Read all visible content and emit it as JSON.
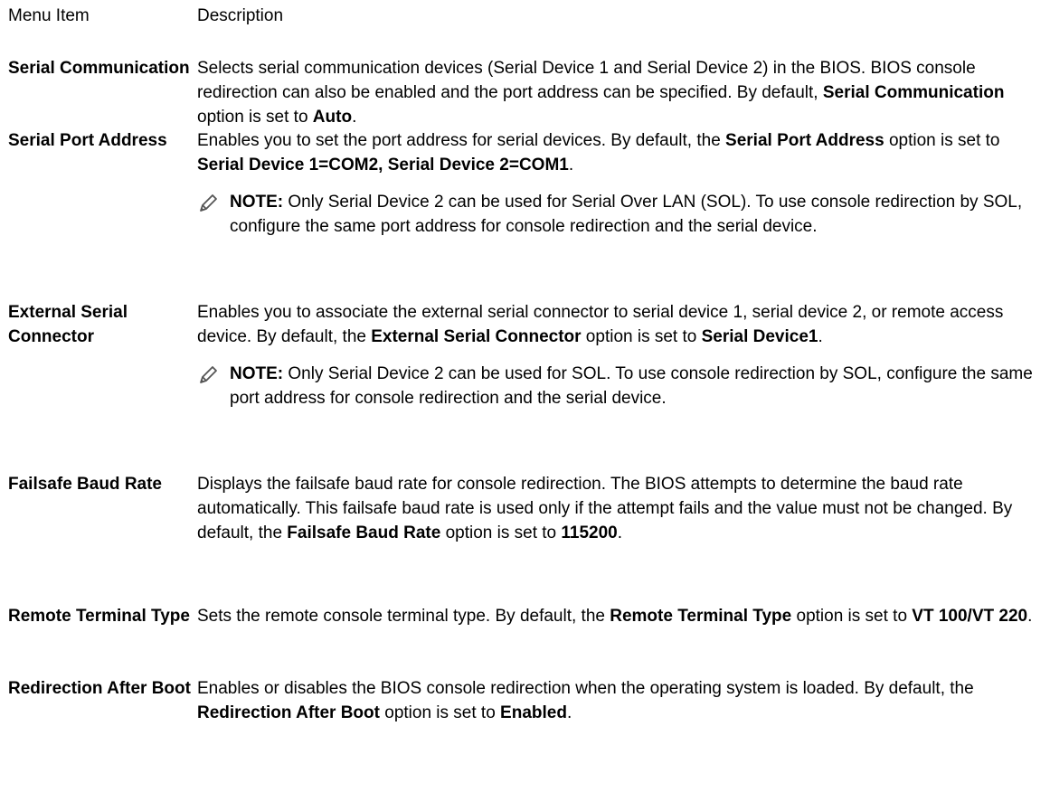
{
  "header": {
    "menu_item": "Menu Item",
    "description": "Description"
  },
  "rows": [
    {
      "name": "Serial Communication",
      "desc": [
        {
          "t": "Selects serial communication devices (Serial Device 1 and Serial Device 2) in the BIOS. BIOS console redirection can also be enabled and the port address can be specified. By default, "
        },
        {
          "t": "Serial Communication",
          "b": true
        },
        {
          "t": " option is set to "
        },
        {
          "t": "Auto",
          "b": true
        },
        {
          "t": "."
        }
      ]
    },
    {
      "name": "Serial Port Address",
      "desc": [
        {
          "t": "Enables you to set the port address for serial devices. By default, the "
        },
        {
          "t": "Serial Port Address",
          "b": true
        },
        {
          "t": " option is set to "
        },
        {
          "t": "Serial Device 1=COM2, Serial Device 2=COM1",
          "b": true
        },
        {
          "t": "."
        }
      ],
      "note": {
        "icon": "note-pencil-icon",
        "label": "NOTE:",
        "text": " Only Serial Device 2 can be used for Serial Over LAN (SOL). To use console redirection by SOL, configure the same port address for console redirection and the serial device."
      }
    },
    {
      "name": "External Serial Connector",
      "desc": [
        {
          "t": "Enables you to associate the external serial connector to serial device 1, serial device 2, or remote access device. By default, the "
        },
        {
          "t": "External Serial Connector",
          "b": true
        },
        {
          "t": " option is set to "
        },
        {
          "t": "Serial Device1",
          "b": true
        },
        {
          "t": "."
        }
      ],
      "note": {
        "icon": "note-pencil-icon",
        "label": "NOTE:",
        "text": " Only Serial Device 2 can be used for SOL. To use console redirection by SOL, configure the same port address for console redirection and the serial device."
      }
    },
    {
      "name": "Failsafe Baud Rate",
      "desc": [
        {
          "t": "Displays the failsafe baud rate for console redirection. The BIOS attempts to determine the baud rate automatically. This failsafe baud rate is used only if the attempt fails and the value must not be changed. By default, the "
        },
        {
          "t": "Failsafe Baud Rate",
          "b": true
        },
        {
          "t": " option is set to "
        },
        {
          "t": "115200",
          "b": true
        },
        {
          "t": "."
        }
      ]
    },
    {
      "name": "Remote Terminal Type",
      "desc": [
        {
          "t": "Sets the remote console terminal type. By default, the "
        },
        {
          "t": "Remote Terminal Type",
          "b": true
        },
        {
          "t": " option is set to "
        },
        {
          "t": "VT 100/VT 220",
          "b": true
        },
        {
          "t": "."
        }
      ]
    },
    {
      "name": "Redirection After Boot",
      "desc": [
        {
          "t": "Enables or disables the BIOS console redirection when the operating system is loaded. By default, the "
        },
        {
          "t": "Redirection After Boot",
          "b": true
        },
        {
          "t": " option is set to "
        },
        {
          "t": "Enabled",
          "b": true
        },
        {
          "t": "."
        }
      ]
    }
  ]
}
